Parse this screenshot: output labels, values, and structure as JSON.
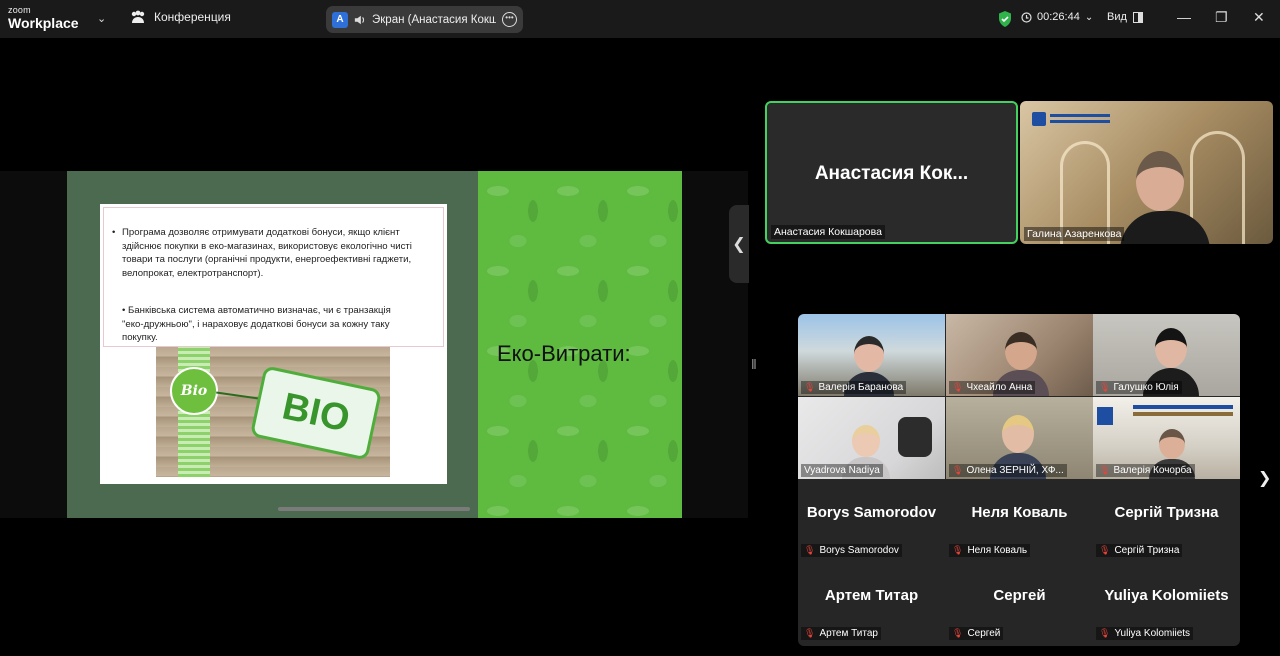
{
  "app": {
    "logo_top": "zoom",
    "logo_bottom": "Workplace",
    "meeting_label": "Конференция",
    "share_badge": "A",
    "share_label": "Экран (Анастасия Кокшарова)",
    "timer": "00:26:44",
    "view_label": "Вид",
    "window_controls": [
      "minimize-icon",
      "restore-icon",
      "close-icon"
    ],
    "colors": {
      "active_speaker_border": "#43d25e",
      "muted_mic": "#e8443a",
      "secure_shield": "#2fb34a"
    }
  },
  "slide": {
    "title": "Еко-Витрати:",
    "bullet1": "Програма дозволяє отримувати додаткові бонуси, якщо клієнт здійснює покупки в еко-магазинах, використовує екологічно чисті товари та послуги (органічні продукти, енергоефективні гаджети, велопрокат, електротранспорт).",
    "bullet2": "• Банківська система автоматично визначає, чи є транзакція \"еко-дружньою\", і нараховує додаткові бонуси за кожну таку покупку.",
    "image_badge": "Bio",
    "image_tag": "BIO"
  },
  "speakers": [
    {
      "display": "Анастасия  Кок...",
      "name": "Анастасия Кокшарова"
    },
    {
      "name": "Галина Азаренкова"
    }
  ],
  "gallery": [
    {
      "name": "Валерія Баранова"
    },
    {
      "name": "Чхеайло Анна"
    },
    {
      "name": "Галушко Юлія"
    },
    {
      "name": "Vyadrova Nadiya"
    },
    {
      "name": "Олена ЗЕРНІЙ, ХФ..."
    },
    {
      "name": "Валерія Кочорба"
    }
  ],
  "name_tiles": [
    {
      "big": "Borys Samorodov",
      "name": "Borys Samorodov"
    },
    {
      "big": "Неля Коваль",
      "name": "Неля Коваль"
    },
    {
      "big": "Сергій Тризна",
      "name": "Сергій Тризна"
    },
    {
      "big": "Артем Титар",
      "name": "Артем Титар"
    },
    {
      "big": "Сергей",
      "name": "Сергей"
    },
    {
      "big": "Yuliya Kolomiiets",
      "name": "Yuliya Kolomiiets"
    }
  ]
}
